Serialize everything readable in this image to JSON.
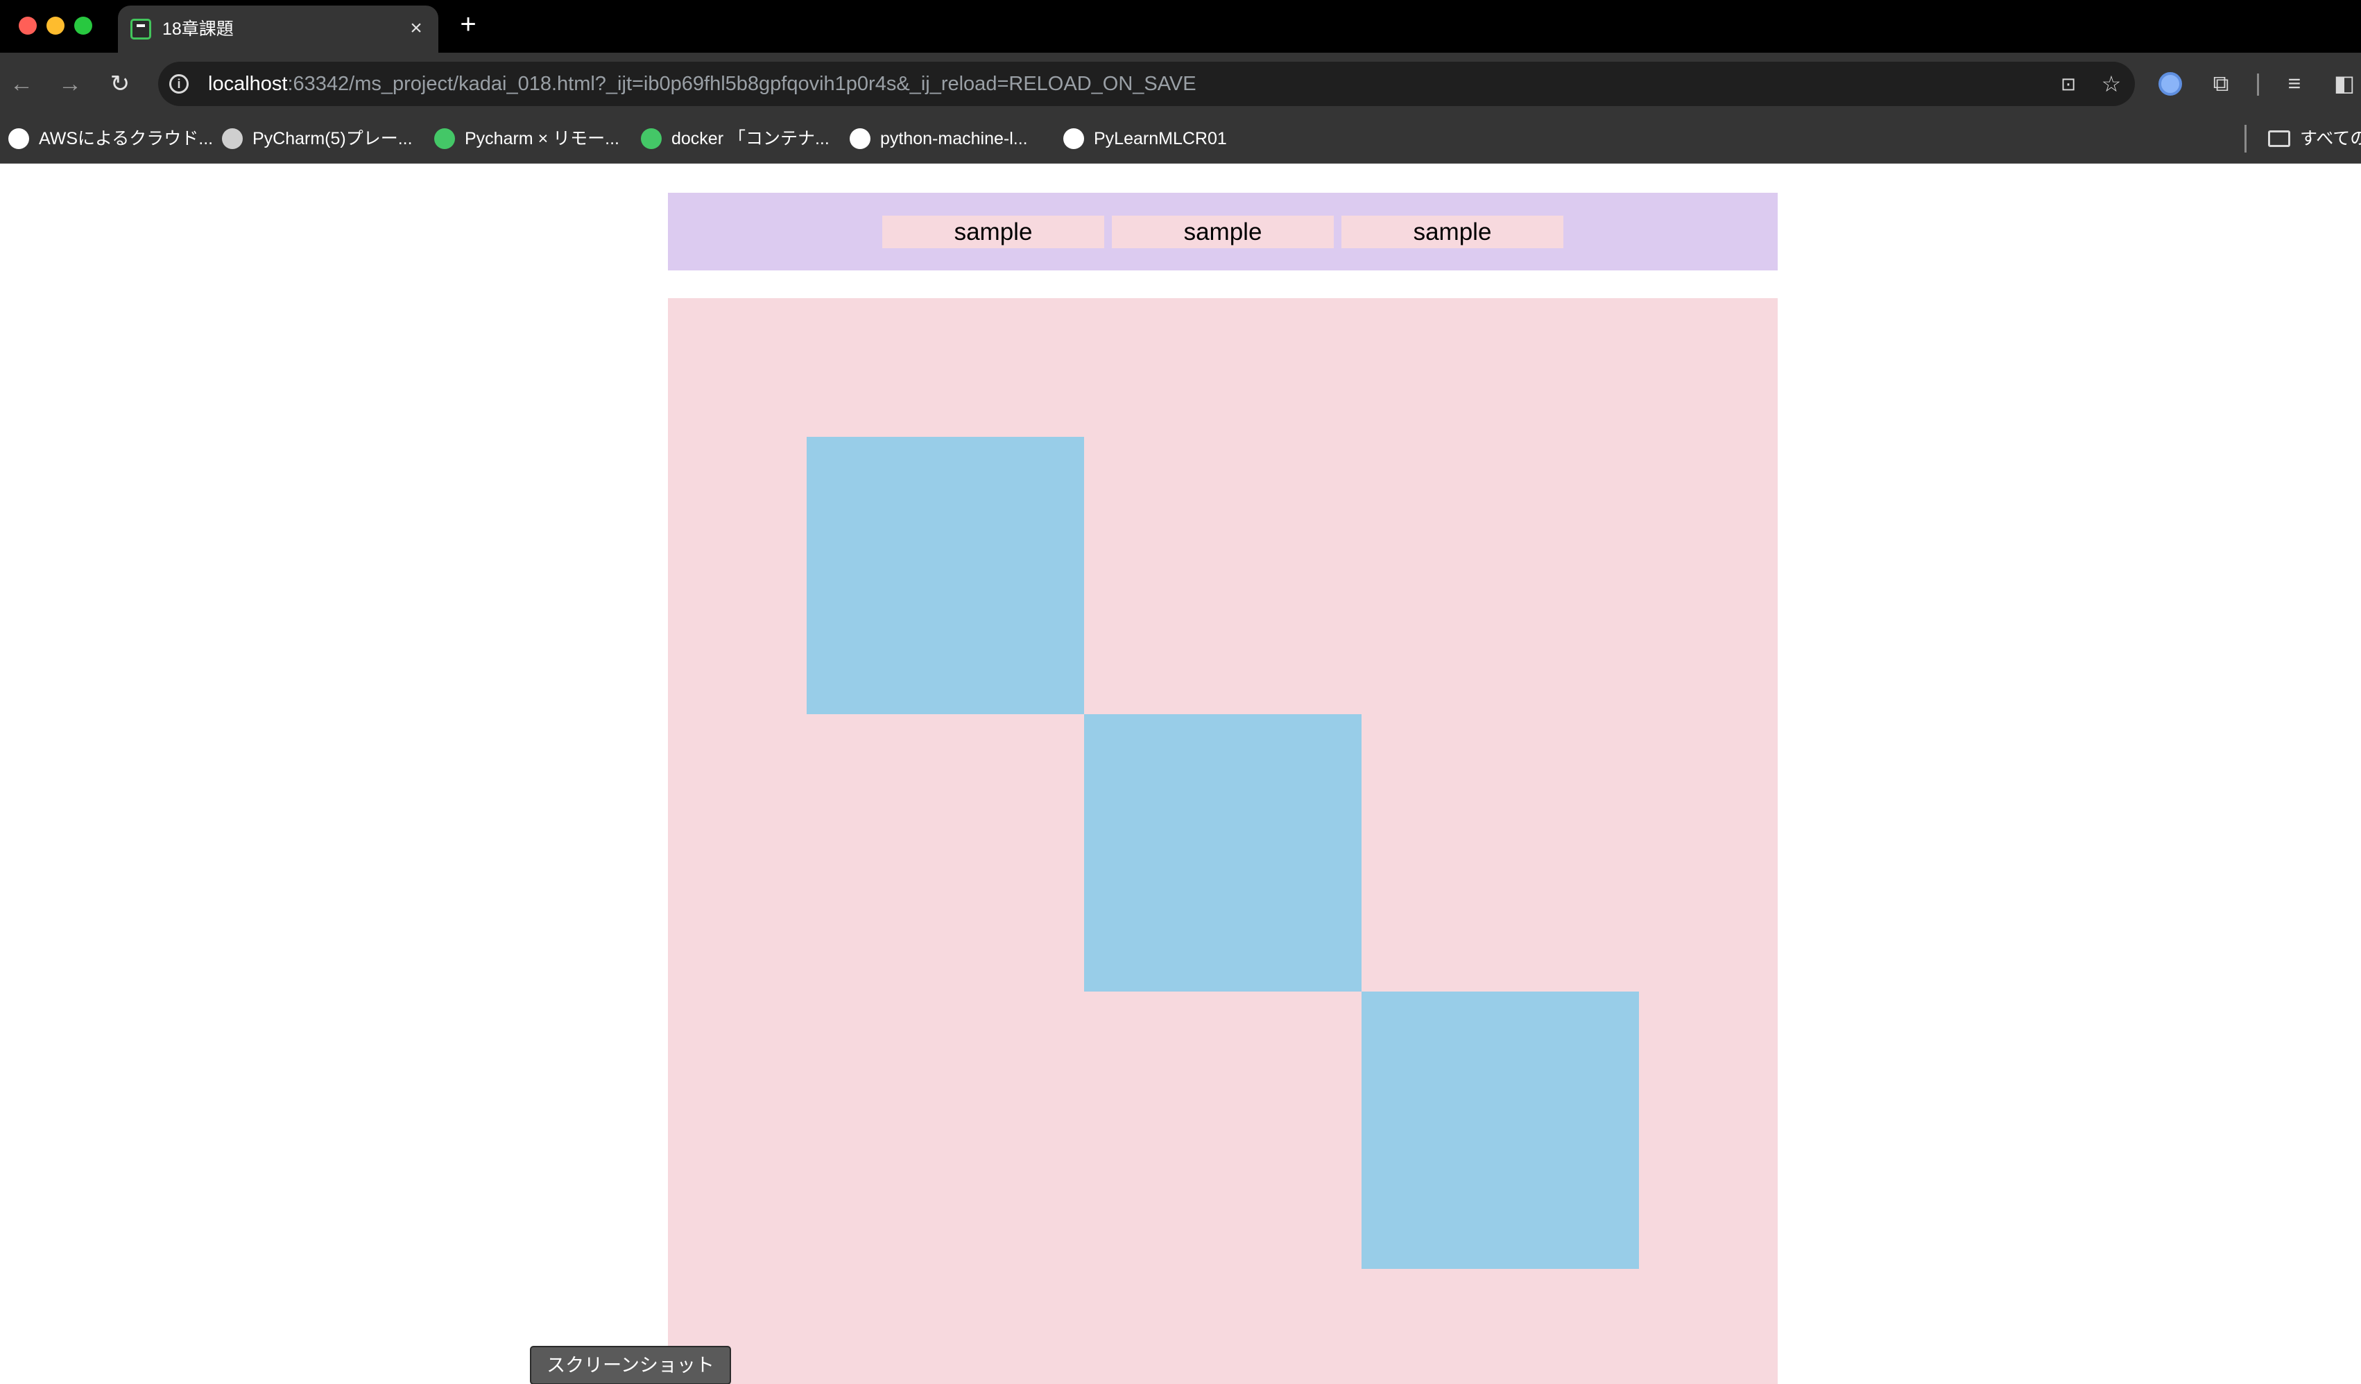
{
  "browser": {
    "tab": {
      "title": "18章課題",
      "close_glyph": "×",
      "new_tab_glyph": "+"
    },
    "url": {
      "host": "localhost",
      "rest": ":63342/ms_project/kadai_018.html?_ijt=ib0p69fhl5b8gpfqovih1p0r4s&_ij_reload=RELOAD_ON_SAVE"
    },
    "nav": {
      "back_glyph": "←",
      "forward_glyph": "→",
      "reload_glyph": "↻",
      "info_glyph": "i"
    },
    "icons": [
      "translate-icon",
      "star-icon",
      "profile-icon",
      "extensions-icon",
      "reading-list-icon",
      "side-panel-icon"
    ],
    "bookmarks": [
      {
        "label": "AWSによるクラウド...",
        "icon_color": "#ffffff"
      },
      {
        "label": "PyCharm(5)プレー...",
        "icon_color": "#cfcfcf"
      },
      {
        "label": "Pycharm × リモー...",
        "icon_color": "#44c767"
      },
      {
        "label": "docker 「コンテナ...",
        "icon_color": "#44c767"
      },
      {
        "label": "python-machine-l...",
        "icon_color": "#ffffff"
      },
      {
        "label": "PyLearnMLCR01",
        "icon_color": "#ffffff"
      }
    ],
    "all_bookmarks_label": "すべての"
  },
  "page": {
    "header_buttons": [
      "sample",
      "sample",
      "sample"
    ],
    "screenshot_button": "スクリーンショット",
    "colors": {
      "header_bg": "#dccbf0",
      "button_bg": "#f7d9de",
      "main_bg": "#f7d9de",
      "square": "#98cde8"
    }
  }
}
